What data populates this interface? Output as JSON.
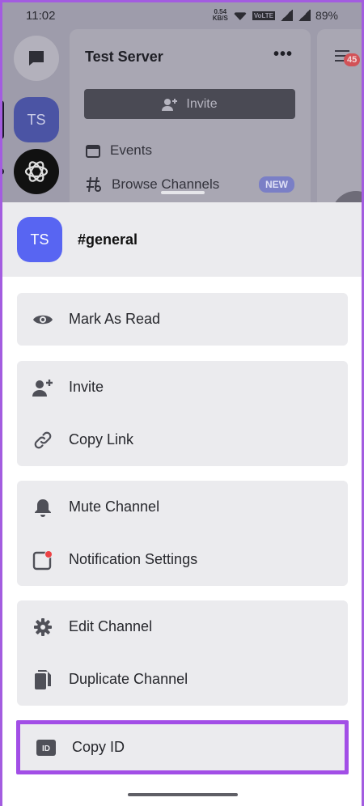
{
  "status_bar": {
    "time": "11:02",
    "net_speed_value": "0.54",
    "net_speed_unit": "KB/S",
    "volte": "VoLTE",
    "battery": "89%"
  },
  "background": {
    "rail_server_initials": "TS",
    "server_name": "Test Server",
    "menu_dots": "•••",
    "invite_label": "Invite",
    "events_label": "Events",
    "browse_label": "Browse Channels",
    "new_badge": "NEW",
    "unread_count": "45"
  },
  "sheet": {
    "channel_avatar_initials": "TS",
    "channel_name": "#general",
    "groups": [
      {
        "items": [
          {
            "icon": "eye-icon",
            "label": "Mark As Read"
          }
        ]
      },
      {
        "items": [
          {
            "icon": "add-user-icon",
            "label": "Invite"
          },
          {
            "icon": "link-icon",
            "label": "Copy Link"
          }
        ]
      },
      {
        "items": [
          {
            "icon": "bell-icon",
            "label": "Mute Channel"
          },
          {
            "icon": "notification-settings-icon",
            "label": "Notification Settings"
          }
        ]
      },
      {
        "items": [
          {
            "icon": "gear-icon",
            "label": "Edit Channel"
          },
          {
            "icon": "duplicate-icon",
            "label": "Duplicate Channel"
          }
        ]
      },
      {
        "items": [
          {
            "icon": "id-icon",
            "label": "Copy ID"
          }
        ]
      }
    ],
    "id_icon_text": "ID"
  },
  "colors": {
    "accent": "#5865f2",
    "highlight_border": "#a24ee6",
    "notification_dot": "#ed4245"
  }
}
